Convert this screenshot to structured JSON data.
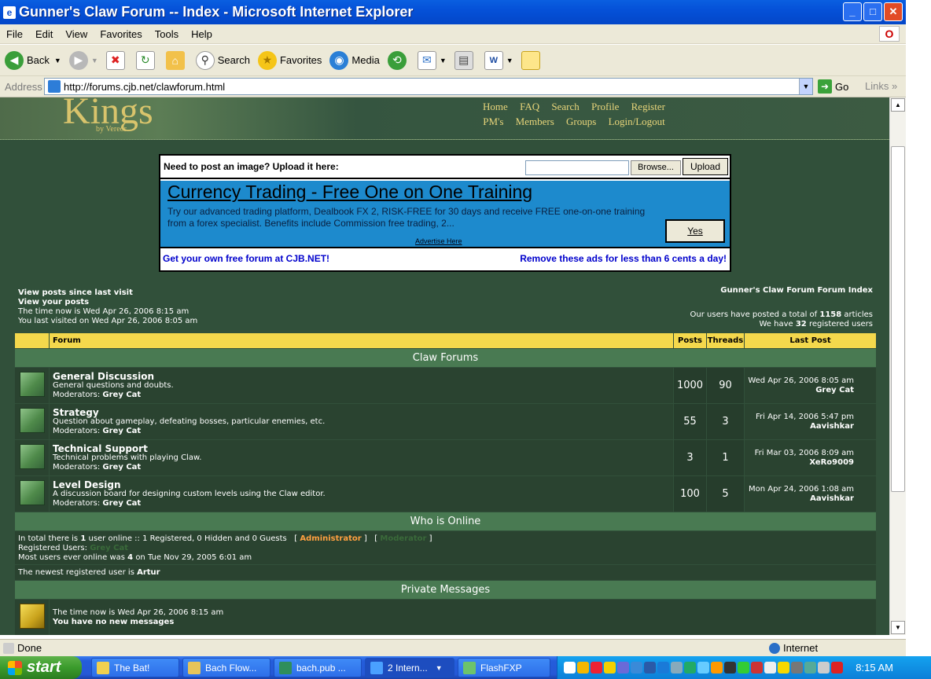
{
  "window": {
    "title": "Gunner's Claw Forum -- Index - Microsoft Internet Explorer"
  },
  "menu": [
    "File",
    "Edit",
    "View",
    "Favorites",
    "Tools",
    "Help"
  ],
  "toolbar": {
    "back": "Back",
    "search": "Search",
    "favorites": "Favorites",
    "media": "Media"
  },
  "address": {
    "label": "Address",
    "url": "http://forums.cjb.net/clawforum.html",
    "go": "Go",
    "links": "Links"
  },
  "site": {
    "brand": "Kings",
    "brand_by": "by Vereor",
    "nav_row1": [
      "Home",
      "FAQ",
      "Search",
      "Profile",
      "Register"
    ],
    "nav_row2": [
      "PM's",
      "Members",
      "Groups",
      "Login/Logout"
    ]
  },
  "ad": {
    "upload_prompt": "Need to post an image? Upload it here:",
    "browse": "Browse...",
    "upload": "Upload",
    "headline": "Currency Trading - Free One on One Training",
    "body": "Try our advanced trading platform, Dealbook FX 2, RISK-FREE for 30 days and receive FREE one-on-one training from a forex specialist. Benefits include Commission free trading, 2...",
    "yes": "Yes",
    "advertise": "Advertise Here",
    "link_left": "Get your own free forum at CJB.NET!",
    "link_right": "Remove these ads for less than 6 cents a day!"
  },
  "info": {
    "view_since": "View posts since last visit",
    "view_yours": "View your posts",
    "time_now": "The time now is Wed Apr 26, 2006 8:15 am",
    "last_visit": "You last visited on Wed Apr 26, 2006 8:05 am",
    "index_link": "Gunner's Claw Forum Forum Index",
    "posted_total_pre": "Our users have posted a total of",
    "posted_total": "1158",
    "posted_total_post": "articles",
    "registered_pre": "We have",
    "registered": "32",
    "registered_post": "registered users"
  },
  "table": {
    "headers": {
      "forum": "Forum",
      "posts": "Posts",
      "threads": "Threads",
      "last_post": "Last Post"
    },
    "category": "Claw Forums",
    "moderators_label": "Moderators:",
    "forums": [
      {
        "name": "General Discussion",
        "desc": "General questions and doubts.",
        "mod": "Grey Cat",
        "posts": "1000",
        "threads": "90",
        "last_date": "Wed Apr 26, 2006 8:05 am",
        "last_user": "Grey Cat"
      },
      {
        "name": "Strategy",
        "desc": "Question about gameplay, defeating bosses, particular enemies, etc.",
        "mod": "Grey Cat",
        "posts": "55",
        "threads": "3",
        "last_date": "Fri Apr 14, 2006 5:47 pm",
        "last_user": "Aavishkar"
      },
      {
        "name": "Technical Support",
        "desc": "Technical problems with playing Claw.",
        "mod": "Grey Cat",
        "posts": "3",
        "threads": "1",
        "last_date": "Fri Mar 03, 2006 8:09 am",
        "last_user": "XeRo9009"
      },
      {
        "name": "Level Design",
        "desc": "A discussion board for designing custom levels using the Claw editor.",
        "mod": "Grey Cat",
        "posts": "100",
        "threads": "5",
        "last_date": "Mon Apr 24, 2006 1:08 am",
        "last_user": "Aavishkar"
      }
    ]
  },
  "online": {
    "title": "Who is Online",
    "line1_pre": "In total there is",
    "line1_count": "1",
    "line1_post": "user online :: 1 Registered, 0 Hidden and 0 Guests",
    "admin": "Administrator",
    "registered_users": "Registered Users:",
    "most_pre": "Most users ever online was",
    "most_count": "4",
    "most_post": "on Tue Nov 29, 2005 6:01 am",
    "newest_pre": "The newest registered user is",
    "newest_user": "Artur"
  },
  "pm": {
    "title": "Private Messages",
    "time": "The time now is Wed Apr 26, 2006 8:15 am",
    "status": "You have no new messages"
  },
  "status": {
    "text": "Done",
    "zone": "Internet"
  },
  "taskbar": {
    "start": "start",
    "tasks": [
      "The Bat!",
      "Bach Flow...",
      "bach.pub ...",
      "2 Intern...",
      "FlashFXP"
    ],
    "clock": "8:15 AM"
  }
}
